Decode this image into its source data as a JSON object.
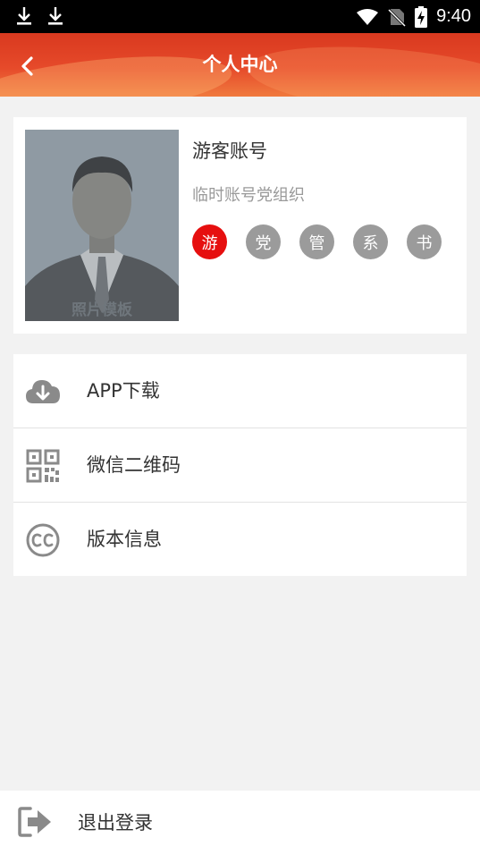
{
  "status_bar": {
    "time": "9:40",
    "icons": [
      "download-icon",
      "download-icon",
      "wifi-icon",
      "no-sim-icon",
      "battery-charging-icon"
    ]
  },
  "header": {
    "title": "个人中心",
    "back_icon": "chevron-left-icon",
    "gradient_colors": [
      "#d9391f",
      "#f07a3e"
    ]
  },
  "profile": {
    "photo_watermark": "照片模板",
    "name": "游客账号",
    "organization": "临时账号党组织",
    "badges": [
      {
        "label": "游",
        "active": true,
        "color": "#e60f0f"
      },
      {
        "label": "党",
        "active": false,
        "color": "#9b9b9b"
      },
      {
        "label": "管",
        "active": false,
        "color": "#9b9b9b"
      },
      {
        "label": "系",
        "active": false,
        "color": "#9b9b9b"
      },
      {
        "label": "书",
        "active": false,
        "color": "#9b9b9b"
      }
    ]
  },
  "menu": {
    "items": [
      {
        "label": "APP下载",
        "icon": "cloud-download-icon"
      },
      {
        "label": "微信二维码",
        "icon": "qr-code-icon"
      },
      {
        "label": "版本信息",
        "icon": "cc-icon"
      }
    ]
  },
  "logout": {
    "label": "退出登录",
    "icon": "logout-icon"
  }
}
